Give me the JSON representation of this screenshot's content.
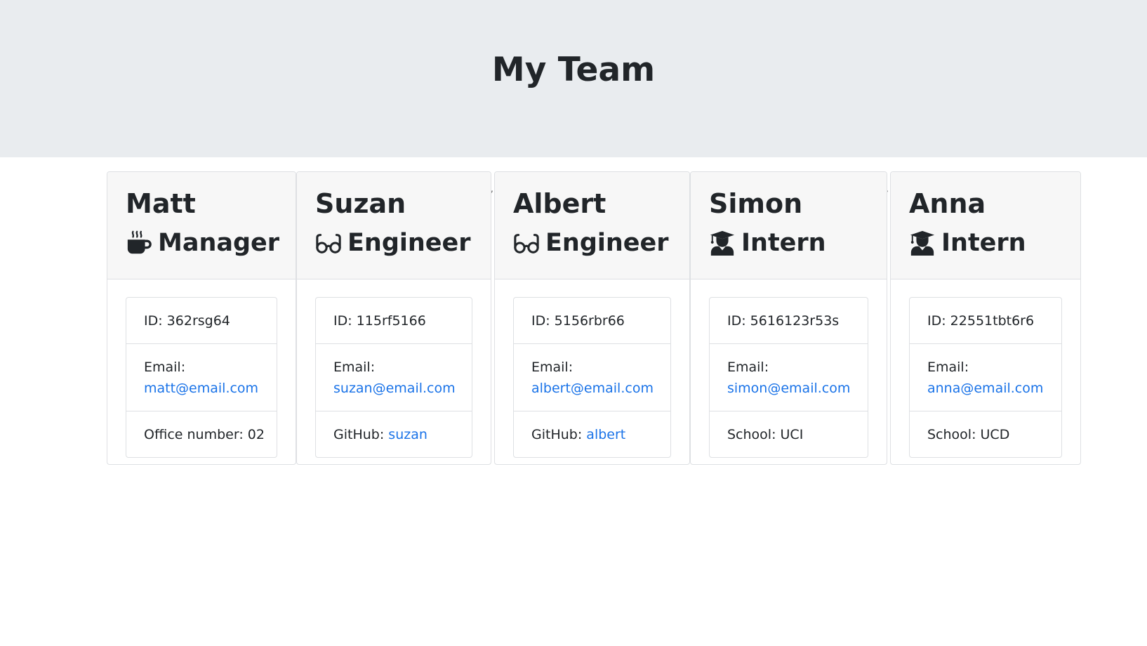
{
  "header": {
    "title": "My Team"
  },
  "team": [
    {
      "name": "Matt",
      "role": "Manager",
      "icon": "coffee-mug-icon",
      "id_text": "ID: 362rsg64",
      "email_label": "Email:",
      "email": "matt@email.com",
      "extra_label": "Office number: 02",
      "extra_link": ""
    },
    {
      "name": "Suzan",
      "role": "Engineer",
      "icon": "glasses-icon",
      "id_text": "ID: 115rf5166",
      "email_label": "Email:",
      "email": "suzan@email.com",
      "extra_label": "GitHub: ",
      "extra_link": "suzan"
    },
    {
      "name": "Albert",
      "role": "Engineer",
      "icon": "glasses-icon",
      "id_text": "ID: 5156rbr66",
      "email_label": "Email:",
      "email": "albert@email.com",
      "extra_label": "GitHub: ",
      "extra_link": "albert"
    },
    {
      "name": "Simon",
      "role": "Intern",
      "icon": "graduate-icon",
      "id_text": "ID: 5616123r53s",
      "email_label": "Email:",
      "email": "simon@email.com",
      "extra_label": "School: UCI",
      "extra_link": ""
    },
    {
      "name": "Anna",
      "role": "Intern",
      "icon": "graduate-icon",
      "id_text": "ID: 22551tbt6r6",
      "email_label": "Email:",
      "email": "anna@email.com",
      "extra_label": "School: UCD",
      "extra_link": ""
    }
  ],
  "stray_marks": [
    ",",
    ","
  ],
  "colors": {
    "link": "#1a73e8",
    "jumbotron_bg": "#e9ecef",
    "card_header_bg": "#f7f7f7",
    "text": "#212529"
  }
}
